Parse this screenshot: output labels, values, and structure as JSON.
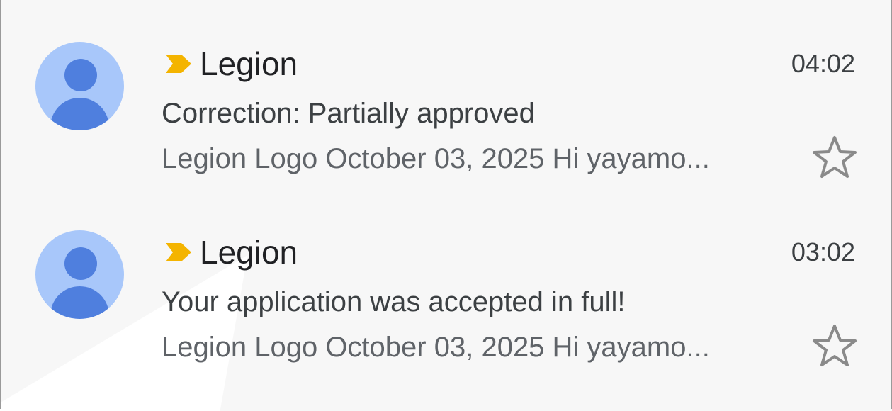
{
  "colors": {
    "avatar_bg": "#a8c7fa",
    "avatar_fg": "#4f7fde",
    "importance_marker": "#f4b400",
    "star_outline": "#8a8a8a"
  },
  "emails": [
    {
      "sender": "Legion",
      "time": "04:02",
      "subject": "Correction: Partially approved",
      "snippet": "Legion Logo October 03, 2025 Hi yayamo...",
      "important": true,
      "starred": false,
      "icons": {
        "avatar": "person-avatar-icon",
        "importance": "importance-marker-icon",
        "star": "star-outline-icon"
      }
    },
    {
      "sender": "Legion",
      "time": "03:02",
      "subject": "Your application was accepted in full!",
      "snippet": "Legion Logo October 03, 2025 Hi yayamo...",
      "important": true,
      "starred": false,
      "icons": {
        "avatar": "person-avatar-icon",
        "importance": "importance-marker-icon",
        "star": "star-outline-icon"
      }
    }
  ]
}
